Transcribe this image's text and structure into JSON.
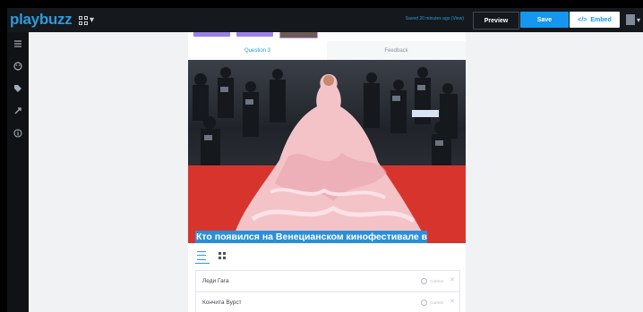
{
  "topbar": {
    "logo": "playbuzz",
    "apps_caret": "▾",
    "saved_text": "Saved 20 minutes ago ",
    "saved_link": "(View)",
    "preview_label": "Preview",
    "save_label": "Save",
    "embed_icon": "</>",
    "embed_label": "Embed",
    "avatar_caret": "▾"
  },
  "sidebar": {
    "icons": [
      "menu-icon",
      "palette-icon",
      "tag-icon",
      "share-icon",
      "info-icon"
    ]
  },
  "editor": {
    "tabs": [
      {
        "label": "Question 3"
      },
      {
        "label": "Feedback"
      }
    ],
    "thumb_colors": [
      "#9b7fe3",
      "#a07fe8",
      "#b9a0e8"
    ],
    "question": "Кто появился на Венецианском кинофестивале в розовом платье из перьев?",
    "answers": [
      {
        "label": "Леди Гага",
        "correct_label": "Correct"
      },
      {
        "label": "Кончита Вурст",
        "correct_label": "Correct"
      }
    ]
  },
  "colors": {
    "brand": "#2b9bdc",
    "save": "#1596ef",
    "topbar": "#15181c"
  }
}
